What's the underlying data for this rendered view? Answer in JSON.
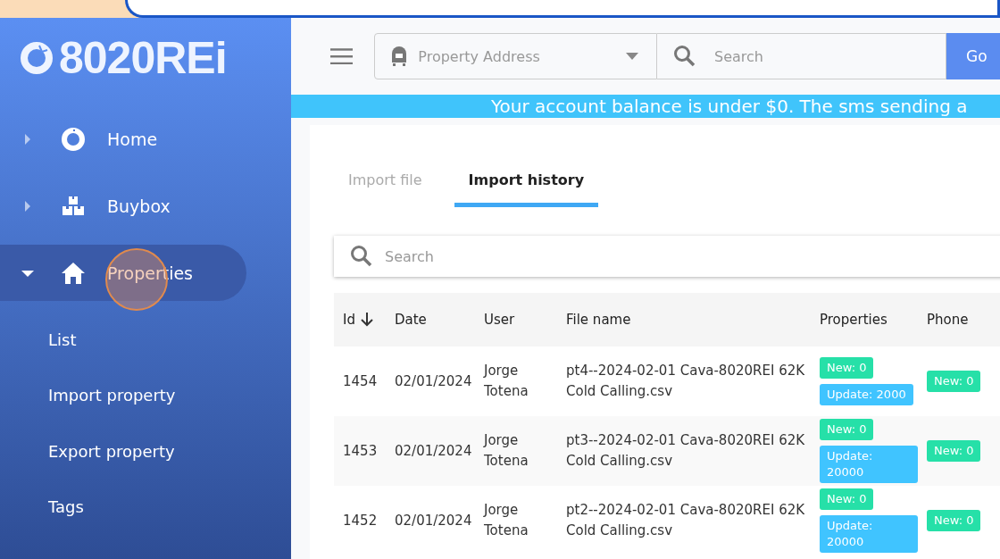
{
  "logo": {
    "text": "8020REi"
  },
  "sidebar": {
    "items": [
      {
        "label": "Home",
        "expanded": false,
        "selected": false
      },
      {
        "label": "Buybox",
        "expanded": false,
        "selected": false
      },
      {
        "label": "Properties",
        "expanded": true,
        "selected": true,
        "children": [
          {
            "label": "List"
          },
          {
            "label": "Import property"
          },
          {
            "label": "Export property"
          },
          {
            "label": "Tags"
          }
        ]
      }
    ]
  },
  "header": {
    "address_select": {
      "placeholder": "Property Address"
    },
    "search": {
      "placeholder": "Search"
    },
    "go_button": "Go"
  },
  "banner": "Your account balance is under $0. The sms sending a",
  "tabs": [
    {
      "label": "Import file",
      "selected": false
    },
    {
      "label": "Import history",
      "selected": true
    }
  ],
  "table_search": {
    "placeholder": "Search"
  },
  "table": {
    "columns": [
      {
        "label": "Id",
        "sorted": true
      },
      {
        "label": "Date",
        "sorted": false
      },
      {
        "label": "User",
        "sorted": false
      },
      {
        "label": "File name",
        "sorted": false
      },
      {
        "label": "Properties",
        "sorted": false
      },
      {
        "label": "Phone",
        "sorted": false
      }
    ],
    "rows": [
      {
        "id": "1454",
        "date": "02/01/2024",
        "user": "Jorge Totena",
        "file": "pt4--2024-02-01 Cava-8020REI 62K Cold Calling.csv",
        "properties": [
          {
            "kind": "new",
            "text": "New: 0"
          },
          {
            "kind": "update",
            "text": "Update: 2000"
          }
        ],
        "phone": [
          {
            "kind": "new",
            "text": "New: 0"
          }
        ]
      },
      {
        "id": "1453",
        "date": "02/01/2024",
        "user": "Jorge Totena",
        "file": "pt3--2024-02-01 Cava-8020REI 62K Cold Calling.csv",
        "properties": [
          {
            "kind": "new",
            "text": "New: 0"
          },
          {
            "kind": "update",
            "text": "Update: 20000"
          }
        ],
        "phone": [
          {
            "kind": "new",
            "text": "New: 0"
          }
        ]
      },
      {
        "id": "1452",
        "date": "02/01/2024",
        "user": "Jorge Totena",
        "file": "pt2--2024-02-01 Cava-8020REI 62K Cold Calling.csv",
        "properties": [
          {
            "kind": "new",
            "text": "New: 0"
          },
          {
            "kind": "update",
            "text": "Update: 20000"
          }
        ],
        "phone": [
          {
            "kind": "new",
            "text": "New: 0"
          }
        ]
      }
    ]
  }
}
